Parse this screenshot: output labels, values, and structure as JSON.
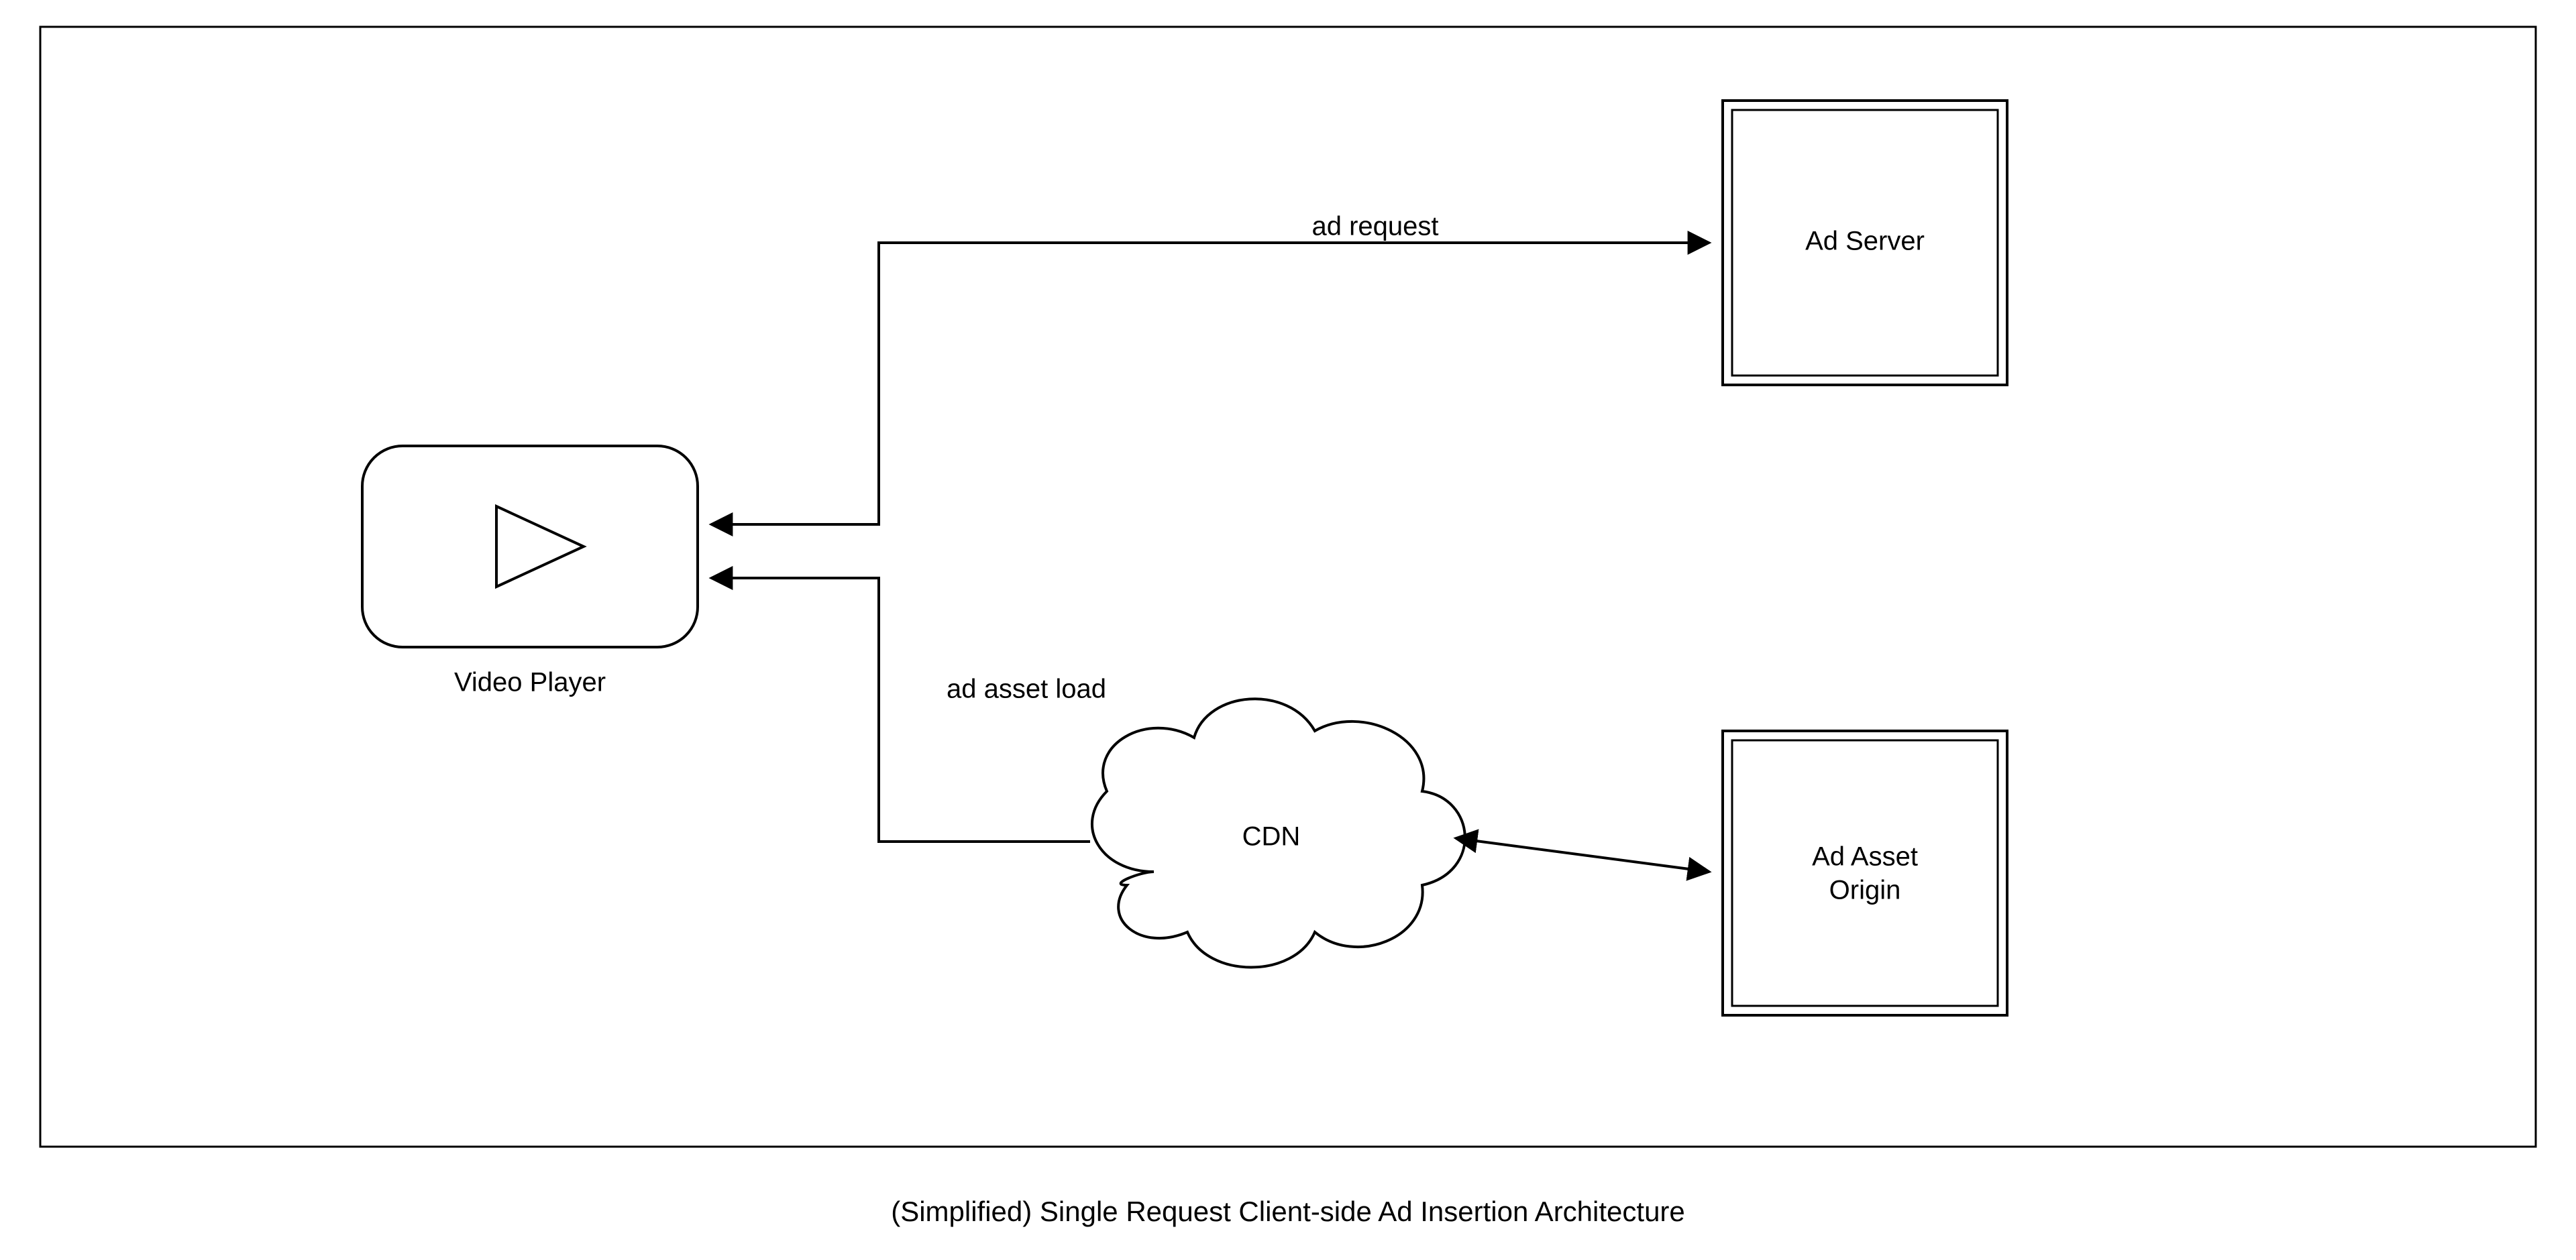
{
  "diagram": {
    "caption": "(Simplified) Single Request Client-side Ad Insertion Architecture",
    "nodes": {
      "video_player": {
        "label": "Video Player"
      },
      "ad_server": {
        "label": "Ad Server"
      },
      "cdn": {
        "label": "CDN"
      },
      "ad_asset_origin": {
        "label_line1": "Ad Asset",
        "label_line2": "Origin"
      }
    },
    "edges": {
      "ad_request": {
        "label": "ad request"
      },
      "ad_asset_load": {
        "label": "ad asset load"
      }
    }
  }
}
